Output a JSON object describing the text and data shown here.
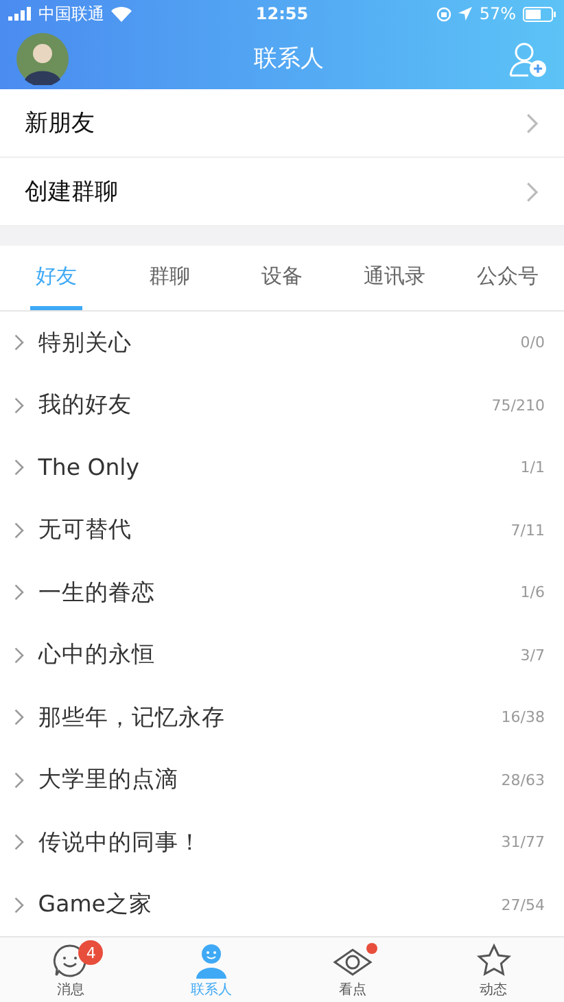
{
  "status_bar": {
    "carrier": "中国联通",
    "time": "12:55",
    "battery": "57%"
  },
  "header": {
    "title": "联系人"
  },
  "menu": [
    {
      "label": "新朋友"
    },
    {
      "label": "创建群聊"
    }
  ],
  "tabs": [
    {
      "label": "好友",
      "selected": true
    },
    {
      "label": "群聊",
      "selected": false
    },
    {
      "label": "设备",
      "selected": false
    },
    {
      "label": "通讯录",
      "selected": false
    },
    {
      "label": "公众号",
      "selected": false
    }
  ],
  "groups": [
    {
      "name": "特别关心",
      "count": "0/0"
    },
    {
      "name": "我的好友",
      "count": "75/210"
    },
    {
      "name": "The Only",
      "count": "1/1"
    },
    {
      "name": "无可替代",
      "count": "7/11"
    },
    {
      "name": "一生的眷恋",
      "count": "1/6"
    },
    {
      "name": "心中的永恒",
      "count": "3/7"
    },
    {
      "name": "那些年，记忆永存",
      "count": "16/38"
    },
    {
      "name": "大学里的点滴",
      "count": "28/63"
    },
    {
      "name": "传说中的同事！",
      "count": "31/77"
    },
    {
      "name": "Game之家",
      "count": "27/54"
    }
  ],
  "tab_bar": [
    {
      "kind": "chat",
      "label": "消息",
      "selected": false,
      "badge": "4"
    },
    {
      "kind": "person",
      "label": "联系人",
      "selected": true
    },
    {
      "kind": "eye",
      "label": "看点",
      "selected": false,
      "dot": true
    },
    {
      "kind": "star",
      "label": "动态",
      "selected": false
    }
  ]
}
